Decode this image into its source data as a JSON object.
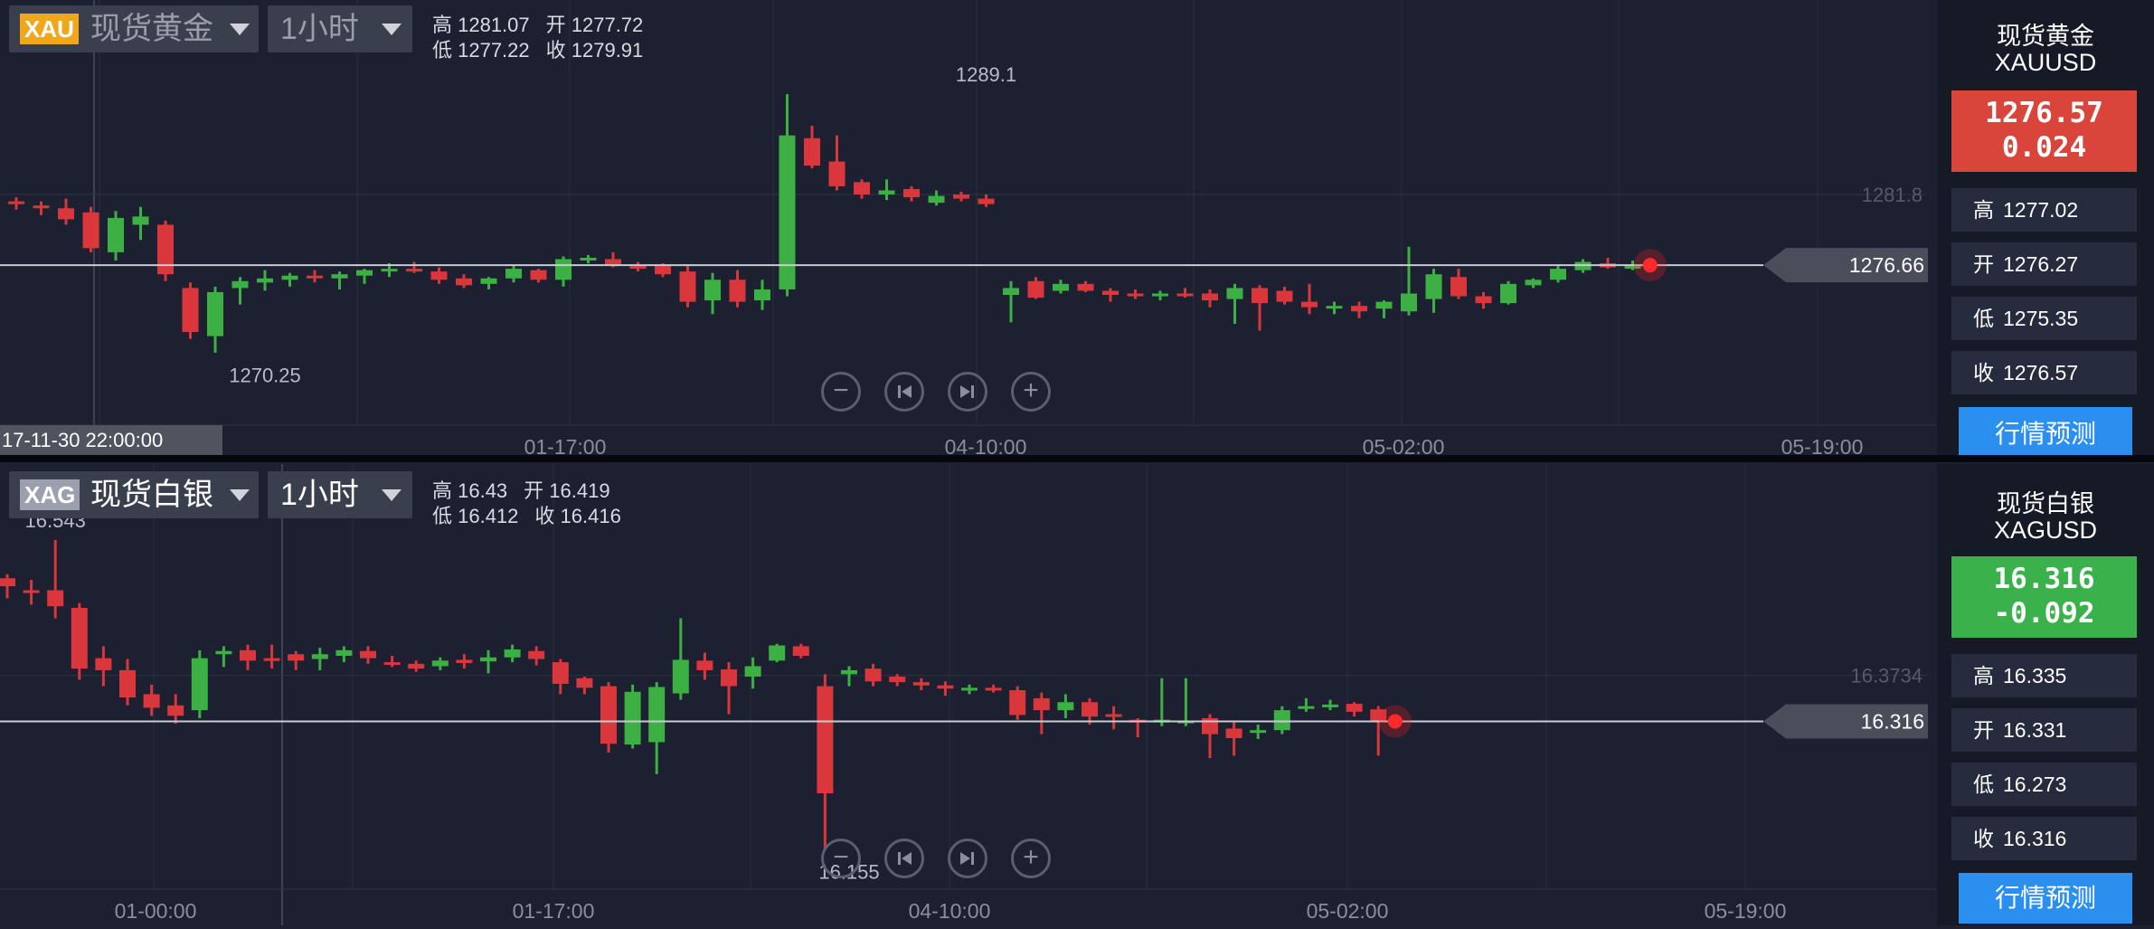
{
  "charts": {
    "gold": {
      "symbol_badge": "XAU",
      "symbol_name": "现货黄金",
      "interval": "1小时",
      "ohlc": {
        "high": "高 1281.07",
        "open": "开 1277.72",
        "low": "低 1277.22",
        "close": "收 1279.91"
      },
      "time_badge": "17-11-30 22:00:00",
      "sidebar": {
        "name": "现货黄金",
        "code": "XAUUSD",
        "price": "1276.57",
        "change": "0.024",
        "high": "1277.02",
        "open": "1276.27",
        "low": "1275.35",
        "close": "1276.57",
        "forecast": "行情预测"
      }
    },
    "silver": {
      "symbol_badge": "XAG",
      "symbol_name": "现货白银",
      "interval": "1小时",
      "ohlc": {
        "high": "高 16.43",
        "open": "开 16.419",
        "low": "低 16.412",
        "close": "收 16.416"
      },
      "sidebar": {
        "name": "现货白银",
        "code": "XAGUSD",
        "price": "16.316",
        "change": "-0.092",
        "high": "16.335",
        "open": "16.331",
        "low": "16.273",
        "close": "16.316",
        "forecast": "行情预测"
      }
    }
  },
  "labels": {
    "high": "高",
    "open": "开",
    "low": "低",
    "close": "收"
  },
  "icons": [
    "zoom-out-icon",
    "step-back-icon",
    "step-forward-icon",
    "zoom-in-icon"
  ],
  "colors": {
    "up": "#3cb043",
    "down": "#d9373b",
    "accent_gold": "#f0a81a",
    "accent_silver": "#9aa0ad",
    "sidebar_up": "#3ab14a",
    "sidebar_down": "#d9453a",
    "button": "#2b8ff0"
  },
  "chart_data": [
    {
      "type": "candlestick",
      "series_name": "现货黄金",
      "categories": [
        "01-17:00",
        "04-10:00",
        "05-02:00",
        "05-19:00"
      ],
      "ylim": [
        1267,
        1292
      ],
      "last_price": 1276.66,
      "price_label": "1276.66",
      "ref_level": 1281.8,
      "ref_label": "1281.8",
      "annotations": [
        {
          "text": "1289.1",
          "index": 39,
          "value": 1289.1
        },
        {
          "text": "1270.25",
          "index": 10,
          "value": 1270.25
        }
      ],
      "candles": [
        [
          1281.3,
          1281.6,
          1280.7,
          1281.1
        ],
        [
          1281.0,
          1281.3,
          1280.3,
          1280.9
        ],
        [
          1280.8,
          1281.5,
          1279.6,
          1280.0
        ],
        [
          1280.5,
          1280.9,
          1277.6,
          1277.9
        ],
        [
          1277.6,
          1280.6,
          1277.0,
          1280.1
        ],
        [
          1279.6,
          1280.9,
          1278.5,
          1280.2
        ],
        [
          1279.6,
          1279.9,
          1275.5,
          1276.0
        ],
        [
          1275.0,
          1275.4,
          1271.3,
          1271.8
        ],
        [
          1271.5,
          1275.1,
          1270.3,
          1274.7
        ],
        [
          1275.0,
          1275.8,
          1273.8,
          1275.5
        ],
        [
          1275.4,
          1276.3,
          1274.8,
          1275.7
        ],
        [
          1275.6,
          1276.1,
          1275.1,
          1275.9
        ],
        [
          1275.9,
          1276.3,
          1275.4,
          1275.7
        ],
        [
          1275.7,
          1276.2,
          1274.9,
          1276.0
        ],
        [
          1275.9,
          1276.4,
          1275.3,
          1276.3
        ],
        [
          1276.3,
          1276.8,
          1275.8,
          1276.4
        ],
        [
          1276.4,
          1276.9,
          1276.1,
          1276.2
        ],
        [
          1276.2,
          1276.5,
          1275.3,
          1275.6
        ],
        [
          1275.7,
          1276.0,
          1275.0,
          1275.2
        ],
        [
          1275.3,
          1275.8,
          1274.9,
          1275.7
        ],
        [
          1275.7,
          1276.6,
          1275.4,
          1276.4
        ],
        [
          1276.3,
          1276.4,
          1275.4,
          1275.6
        ],
        [
          1275.6,
          1277.3,
          1275.1,
          1277.1
        ],
        [
          1277.1,
          1277.4,
          1276.8,
          1277.2
        ],
        [
          1277.1,
          1277.6,
          1276.5,
          1276.6
        ],
        [
          1276.6,
          1276.9,
          1276.2,
          1276.5
        ],
        [
          1276.6,
          1276.8,
          1275.8,
          1276.0
        ],
        [
          1276.2,
          1276.6,
          1273.6,
          1274.0
        ],
        [
          1274.1,
          1276.1,
          1273.1,
          1275.6
        ],
        [
          1275.6,
          1276.3,
          1273.6,
          1274.0
        ],
        [
          1274.1,
          1275.6,
          1273.4,
          1274.9
        ],
        [
          1274.9,
          1289.1,
          1274.4,
          1286.1
        ],
        [
          1285.9,
          1286.8,
          1283.7,
          1283.9
        ],
        [
          1284.2,
          1286.1,
          1282.1,
          1282.4
        ],
        [
          1282.7,
          1282.9,
          1281.5,
          1281.8
        ],
        [
          1281.8,
          1282.9,
          1281.4,
          1282.1
        ],
        [
          1282.2,
          1282.4,
          1281.3,
          1281.6
        ],
        [
          1281.2,
          1282.1,
          1281.0,
          1281.7
        ],
        [
          1281.8,
          1282.0,
          1281.3,
          1281.5
        ],
        [
          1281.5,
          1281.8,
          1280.9,
          1281.1
        ],
        [
          1274.5,
          1275.5,
          1272.5,
          1275.0
        ],
        [
          1275.5,
          1275.8,
          1274.2,
          1274.3
        ],
        [
          1274.8,
          1275.6,
          1274.6,
          1275.3
        ],
        [
          1275.3,
          1275.5,
          1274.7,
          1274.8
        ],
        [
          1274.8,
          1275.0,
          1274.0,
          1274.5
        ],
        [
          1274.6,
          1274.9,
          1274.2,
          1274.4
        ],
        [
          1274.4,
          1274.8,
          1274.1,
          1274.6
        ],
        [
          1274.6,
          1275.0,
          1274.3,
          1274.5
        ],
        [
          1274.6,
          1274.9,
          1273.6,
          1274.1
        ],
        [
          1274.2,
          1275.3,
          1272.4,
          1275.0
        ],
        [
          1275.0,
          1275.2,
          1271.9,
          1273.9
        ],
        [
          1274.8,
          1275.1,
          1273.8,
          1274.0
        ],
        [
          1274.0,
          1275.3,
          1273.1,
          1273.6
        ],
        [
          1273.6,
          1274.0,
          1273.1,
          1273.7
        ],
        [
          1273.7,
          1274.0,
          1272.8,
          1273.3
        ],
        [
          1273.5,
          1274.1,
          1272.8,
          1274.0
        ],
        [
          1273.3,
          1278.0,
          1273.0,
          1274.6
        ],
        [
          1274.2,
          1276.4,
          1273.2,
          1276.0
        ],
        [
          1275.8,
          1276.4,
          1274.2,
          1274.4
        ],
        [
          1274.4,
          1274.7,
          1273.5,
          1273.9
        ],
        [
          1273.9,
          1275.5,
          1273.8,
          1275.3
        ],
        [
          1275.2,
          1275.7,
          1275.0,
          1275.6
        ],
        [
          1275.6,
          1276.6,
          1275.4,
          1276.4
        ],
        [
          1276.3,
          1277.1,
          1276.1,
          1276.9
        ],
        [
          1276.8,
          1277.2,
          1276.4,
          1276.5
        ],
        [
          1276.5,
          1277.0,
          1276.3,
          1276.6
        ]
      ]
    },
    {
      "type": "candlestick",
      "series_name": "现货白银",
      "categories": [
        "01-00:00",
        "01-17:00",
        "04-10:00",
        "05-02:00",
        "05-19:00"
      ],
      "ylim": [
        16.14,
        16.57
      ],
      "last_price": 16.316,
      "price_label": "16.316",
      "ref_level": 16.3734,
      "ref_label": "16.3734",
      "annotations": [
        {
          "text": "16.543",
          "index": 2,
          "value": 16.543
        },
        {
          "text": "16.155",
          "index": 35,
          "value": 16.155
        }
      ],
      "candles": [
        [
          16.495,
          16.5,
          16.47,
          16.485
        ],
        [
          16.48,
          16.493,
          16.462,
          16.478
        ],
        [
          16.48,
          16.543,
          16.445,
          16.46
        ],
        [
          16.458,
          16.464,
          16.368,
          16.382
        ],
        [
          16.395,
          16.41,
          16.36,
          16.38
        ],
        [
          16.38,
          16.394,
          16.336,
          16.346
        ],
        [
          16.35,
          16.362,
          16.323,
          16.333
        ],
        [
          16.336,
          16.35,
          16.313,
          16.323
        ],
        [
          16.33,
          16.405,
          16.32,
          16.395
        ],
        [
          16.4,
          16.41,
          16.384,
          16.404
        ],
        [
          16.405,
          16.412,
          16.38,
          16.392
        ],
        [
          16.395,
          16.412,
          16.382,
          16.393
        ],
        [
          16.4,
          16.404,
          16.38,
          16.392
        ],
        [
          16.394,
          16.408,
          16.38,
          16.4
        ],
        [
          16.398,
          16.41,
          16.39,
          16.405
        ],
        [
          16.404,
          16.41,
          16.388,
          16.395
        ],
        [
          16.39,
          16.398,
          16.384,
          16.389
        ],
        [
          16.388,
          16.392,
          16.378,
          16.382
        ],
        [
          16.385,
          16.396,
          16.38,
          16.392
        ],
        [
          16.393,
          16.4,
          16.382,
          16.389
        ],
        [
          16.391,
          16.405,
          16.376,
          16.396
        ],
        [
          16.396,
          16.412,
          16.39,
          16.406
        ],
        [
          16.404,
          16.41,
          16.386,
          16.394
        ],
        [
          16.39,
          16.394,
          16.35,
          16.363
        ],
        [
          16.37,
          16.372,
          16.35,
          16.358
        ],
        [
          16.36,
          16.365,
          16.277,
          16.288
        ],
        [
          16.287,
          16.362,
          16.282,
          16.353
        ],
        [
          16.29,
          16.365,
          16.25,
          16.359
        ],
        [
          16.351,
          16.445,
          16.343,
          16.393
        ],
        [
          16.392,
          16.402,
          16.368,
          16.38
        ],
        [
          16.381,
          16.39,
          16.325,
          16.36
        ],
        [
          16.372,
          16.396,
          16.357,
          16.385
        ],
        [
          16.392,
          16.413,
          16.39,
          16.411
        ],
        [
          16.41,
          16.413,
          16.395,
          16.398
        ],
        [
          16.36,
          16.375,
          16.155,
          16.226
        ],
        [
          16.375,
          16.385,
          16.36,
          16.38
        ],
        [
          16.382,
          16.388,
          16.36,
          16.366
        ],
        [
          16.372,
          16.375,
          16.36,
          16.365
        ],
        [
          16.365,
          16.37,
          16.355,
          16.361
        ],
        [
          16.361,
          16.366,
          16.348,
          16.357
        ],
        [
          16.357,
          16.362,
          16.35,
          16.358
        ],
        [
          16.358,
          16.362,
          16.352,
          16.355
        ],
        [
          16.355,
          16.36,
          16.318,
          16.324
        ],
        [
          16.345,
          16.352,
          16.3,
          16.33
        ],
        [
          16.33,
          16.35,
          16.32,
          16.34
        ],
        [
          16.34,
          16.345,
          16.312,
          16.322
        ],
        [
          16.325,
          16.335,
          16.306,
          16.322
        ],
        [
          16.318,
          16.32,
          16.296,
          16.316
        ],
        [
          16.315,
          16.37,
          16.31,
          16.318
        ],
        [
          16.315,
          16.37,
          16.31,
          16.317
        ],
        [
          16.32,
          16.325,
          16.27,
          16.3
        ],
        [
          16.307,
          16.316,
          16.273,
          16.295
        ],
        [
          16.302,
          16.312,
          16.294,
          16.305
        ],
        [
          16.305,
          16.335,
          16.3,
          16.33
        ],
        [
          16.333,
          16.345,
          16.328,
          16.335
        ],
        [
          16.335,
          16.343,
          16.33,
          16.337
        ],
        [
          16.338,
          16.34,
          16.322,
          16.328
        ],
        [
          16.331,
          16.335,
          16.273,
          16.316
        ]
      ]
    }
  ]
}
